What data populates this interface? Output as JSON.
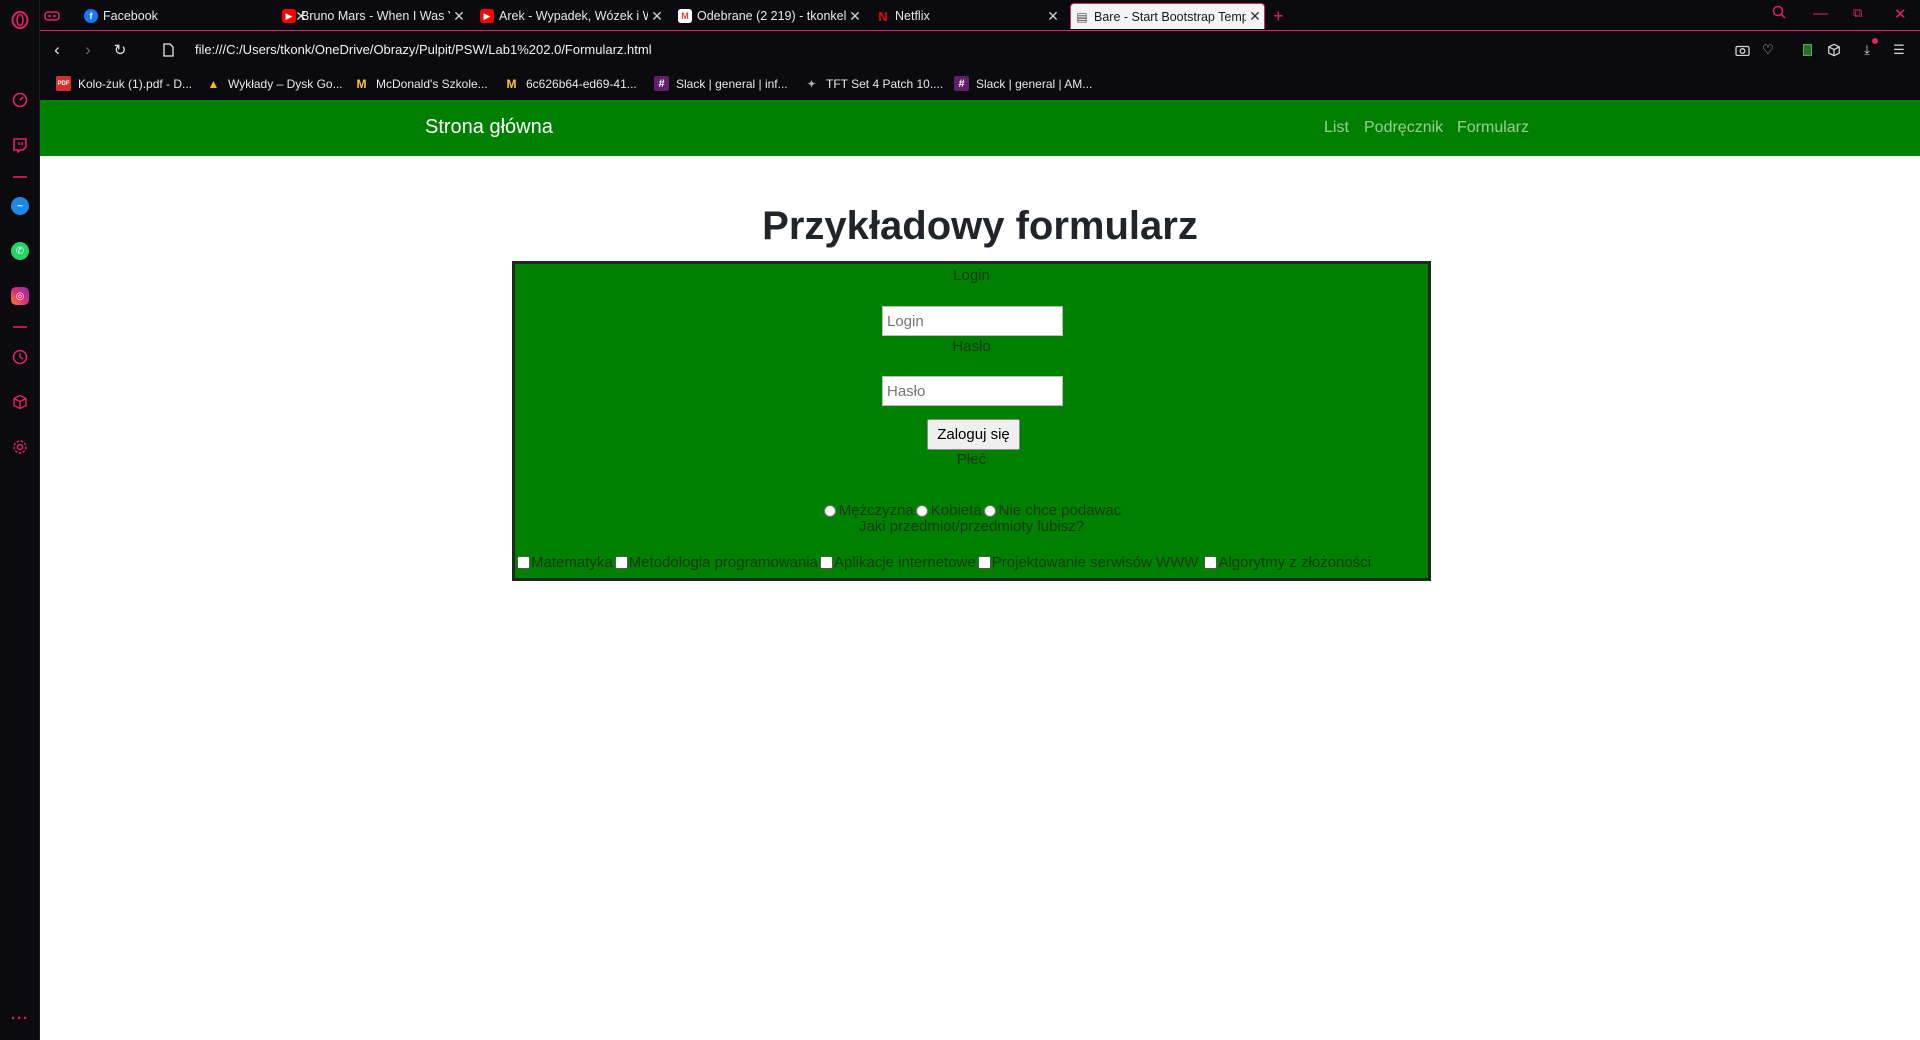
{
  "browser": {
    "tabs": [
      {
        "title": "Facebook",
        "icon": "facebook-icon",
        "color": "#1877f2",
        "glyph": "f"
      },
      {
        "title": "Bruno Mars - When I Was Your Man",
        "icon": "youtube-icon",
        "color": "#ff0000",
        "glyph": "▶"
      },
      {
        "title": "Arek - Wypadek, Wózek i W",
        "icon": "youtube-icon",
        "color": "#ff0000",
        "glyph": "▶"
      },
      {
        "title": "Odebrane (2 219) - tkonkel",
        "icon": "gmail-icon",
        "color": "#ea4335",
        "glyph": "M"
      },
      {
        "title": "Netflix",
        "icon": "netflix-icon",
        "color": "#e50914",
        "glyph": "N"
      },
      {
        "title": "Bare - Start Bootstrap Template",
        "icon": "document-icon",
        "color": "#555555",
        "glyph": "▤",
        "active": true
      }
    ],
    "url": "file:///C:/Users/tkonk/OneDrive/Obrazy/Pulpit/PSW/Lab1%202.0/Formularz.html",
    "bookmarks": [
      {
        "label": "Kolo-żuk (1).pdf - D...",
        "icon": "pdf-icon",
        "glyph": "PDF",
        "color": "#d32f2f"
      },
      {
        "label": "Wykłady – Dysk Go...",
        "icon": "google-drive-icon",
        "glyph": "▲",
        "color": "#fbbc04"
      },
      {
        "label": "McDonald's Szkole...",
        "icon": "mcdonalds-icon",
        "glyph": "M",
        "color": "#ffc72c"
      },
      {
        "label": "6c626b64-ed69-41...",
        "icon": "mcdonalds-icon",
        "glyph": "M",
        "color": "#ffc72c"
      },
      {
        "label": "Slack | general | inf...",
        "icon": "slack-icon",
        "glyph": "#",
        "color": "#611f69"
      },
      {
        "label": "TFT Set 4 Patch 10....",
        "icon": "tft-icon",
        "glyph": "✦",
        "color": "#aaaaaa"
      },
      {
        "label": "Slack | general | AM...",
        "icon": "slack-icon",
        "glyph": "#",
        "color": "#611f69"
      }
    ],
    "accent": "#e0245e"
  },
  "page": {
    "navbar": {
      "brand": "Strona główna",
      "links": [
        "List",
        "Podręcznik",
        "Formularz"
      ],
      "bg": "#008000"
    },
    "title": "Przykładowy formularz",
    "form": {
      "login_label": "Login",
      "login_placeholder": "Login",
      "password_label": "Hasło",
      "password_placeholder": "Hasło",
      "submit_label": "Zaloguj się",
      "gender_label": "Płeć",
      "gender_options": [
        "Mężczyzna",
        "Kobieta",
        "Nie chce podawac"
      ],
      "subjects_label": "Jaki przedmiot/przedmioty lubisz?",
      "subjects": [
        "Matematyka",
        "Metodologia programowania",
        "Aplikacje internetowe",
        "Projektowanie serwisów WWW",
        "Algorytmy z złożoności"
      ]
    }
  }
}
